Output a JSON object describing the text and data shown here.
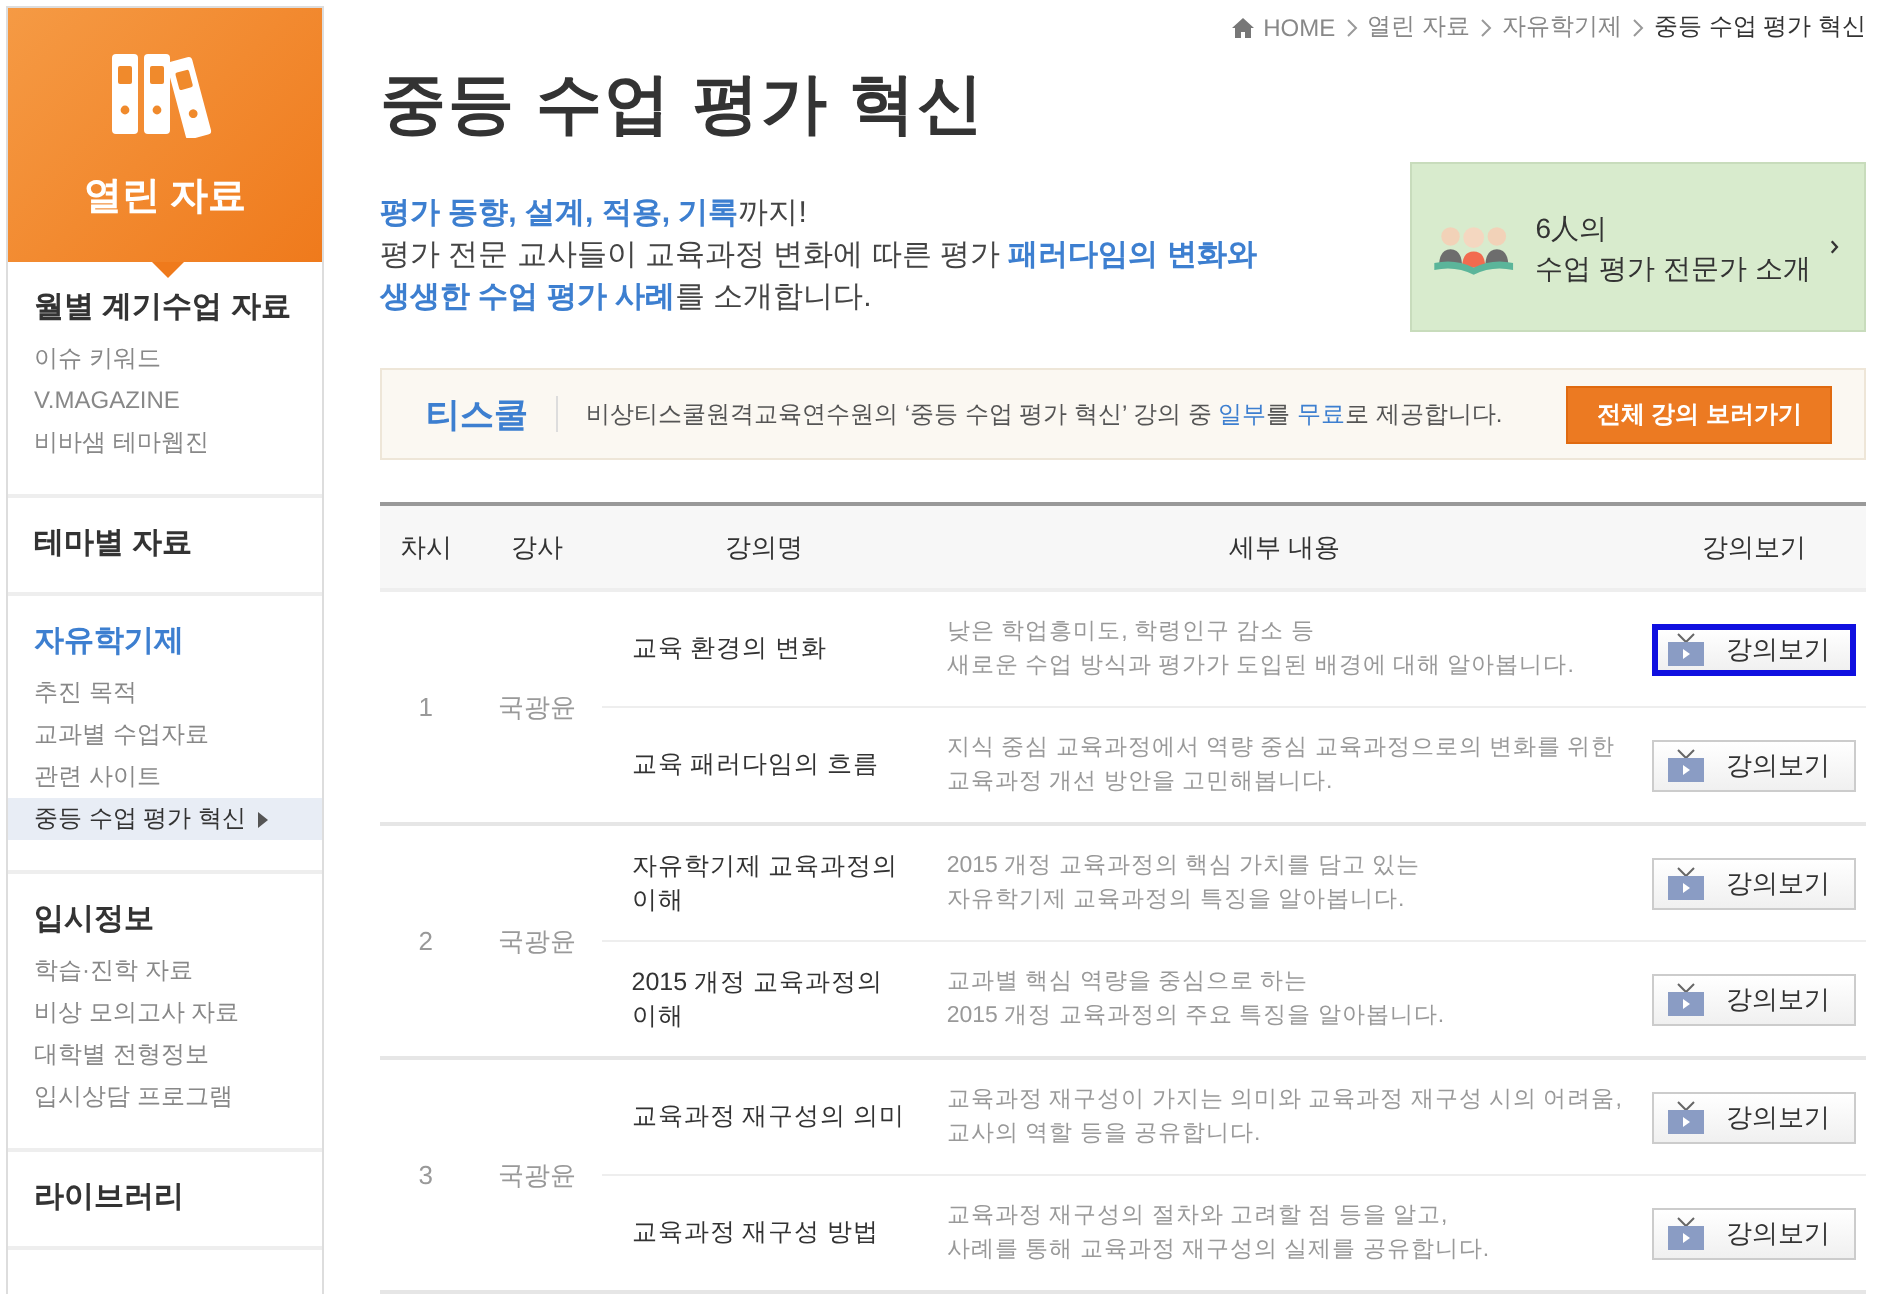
{
  "sidebar": {
    "title": "열린 자료",
    "sections": [
      {
        "title": "월별 계기수업 자료",
        "selected": false,
        "items": [
          {
            "label": "이슈 키워드",
            "selected": false
          },
          {
            "label": "V.MAGAZINE",
            "selected": false
          },
          {
            "label": "비바샘 테마웹진",
            "selected": false
          }
        ]
      },
      {
        "title": "테마별 자료",
        "selected": false
      },
      {
        "title": "자유학기제",
        "selected": true,
        "items": [
          {
            "label": "추진 목적",
            "selected": false
          },
          {
            "label": "교과별 수업자료",
            "selected": false
          },
          {
            "label": "관련 사이트",
            "selected": false
          },
          {
            "label": "중등 수업 평가 혁신",
            "selected": true
          }
        ]
      },
      {
        "title": "입시정보",
        "selected": false,
        "items": [
          {
            "label": "학습·진학 자료",
            "selected": false
          },
          {
            "label": "비상 모의고사 자료",
            "selected": false
          },
          {
            "label": "대학별 전형정보",
            "selected": false
          },
          {
            "label": "입시상담 프로그램",
            "selected": false
          }
        ]
      },
      {
        "title": "라이브러리",
        "selected": false
      }
    ]
  },
  "breadcrumb": [
    "HOME",
    "열린 자료",
    "자유학기제",
    "중등 수업 평가 혁신"
  ],
  "page_title": "중등 수업 평가 혁신",
  "intro": [
    "**평가 동향, 설계, 적용, 기록**까지!",
    "평가 전문 교사들이 교육과정 변화에 따른 평가 **패러다임의 변화와**",
    "**생생한 수업 평가 사례**를 소개합니다."
  ],
  "expert_card": {
    "line_1": "6人의",
    "line_2": "수업 평가 전문가 소개"
  },
  "tschool": {
    "brand": "티스쿨",
    "text": "비상티스쿨원격교육연수원의 ‘중등 수업 평가 혁신’ 강의 중 **일부**를 **무료**로 제공합니다.",
    "button": "전체 강의 보러가기"
  },
  "table": {
    "columns": [
      "차시",
      "강사",
      "강의명",
      "세부 내용",
      "강의보기"
    ],
    "sessions": [
      {
        "number": "1",
        "instructor": "국광윤",
        "lectures": [
          {
            "title": "교육 환경의 변화",
            "description": [
              "낮은 학업흥미도, 학령인구 감소 등",
              "새로운 수업 방식과 평가가 도입된 배경에 대해 알아봅니다."
            ],
            "button": "강의보기",
            "highlighted": true
          },
          {
            "title": "교육 패러다임의 흐름",
            "description": [
              "지식 중심 교육과정에서 역량 중심 교육과정으로의 변화를 위한",
              "교육과정 개선 방안을 고민해봅니다."
            ],
            "button": "강의보기",
            "highlighted": false
          }
        ]
      },
      {
        "number": "2",
        "instructor": "국광윤",
        "lectures": [
          {
            "title": "자유학기제 교육과정의 이해",
            "description": [
              "2015 개정 교육과정의 핵심 가치를 담고 있는",
              "자유학기제 교육과정의 특징을 알아봅니다."
            ],
            "button": "강의보기",
            "highlighted": false
          },
          {
            "title": "2015 개정 교육과정의 이해",
            "description": [
              "교과별 핵심 역량을 중심으로 하는",
              "2015 개정 교육과정의 주요 특징을 알아봅니다."
            ],
            "button": "강의보기",
            "highlighted": false
          }
        ]
      },
      {
        "number": "3",
        "instructor": "국광윤",
        "lectures": [
          {
            "title": "교육과정 재구성의 의미",
            "description": [
              "교육과정 재구성이 가지는 의미와 교육과정 재구성 시의 어려움,",
              "교사의 역할 등을 공유합니다."
            ],
            "button": "강의보기",
            "highlighted": false
          },
          {
            "title": "교육과정 재구성 방법",
            "description": [
              "교육과정 재구성의 절차와 고려할 점 등을 알고,",
              "사례를 통해 교육과정 재구성의 실제를 공유합니다."
            ],
            "button": "강의보기",
            "highlighted": false
          }
        ]
      }
    ]
  }
}
